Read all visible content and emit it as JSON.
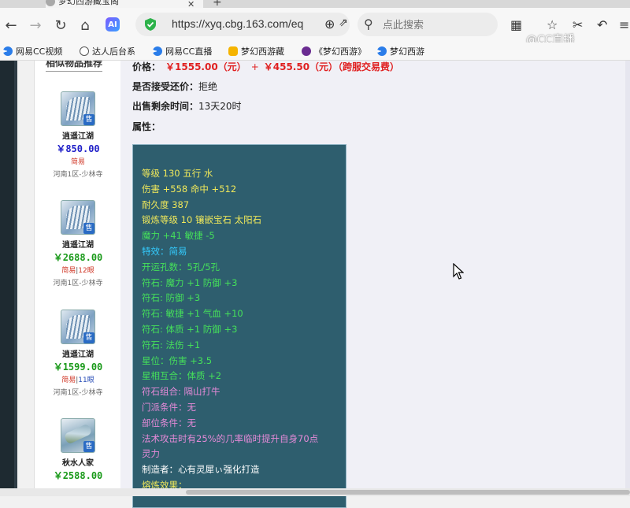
{
  "browser": {
    "tab_title": "梦幻西游藏宝阁",
    "url": "https://xyq.cbg.163.com/eq",
    "search_placeholder": "点此搜索",
    "ai_label": "AI",
    "watermark": "@CC直播",
    "bookmarks": [
      {
        "label": "网易CC视频",
        "icon": "cc-icon"
      },
      {
        "label": "达人后台系",
        "icon": "globe-icon"
      },
      {
        "label": "网易CC直播",
        "icon": "cc-icon"
      },
      {
        "label": "梦幻西游藏",
        "icon": "duck-icon"
      },
      {
        "label": "《梦幻西游》",
        "icon": "mhxy-icon"
      },
      {
        "label": "梦幻西游",
        "icon": "cc-icon"
      }
    ]
  },
  "sidebar": {
    "title": "相似物品推荐",
    "sale_badge": "售",
    "items": [
      {
        "name": "逍遥江湖",
        "price": "￥850.00",
        "price_color": "#2020c8",
        "tag": "简易",
        "tag_extra": "",
        "server": "河南1区-少林寺"
      },
      {
        "name": "逍遥江湖",
        "price": "￥2688.00",
        "price_color": "#1a9a1a",
        "tag": "简易",
        "tag_extra": "12眼",
        "server": "河南1区-少林寺"
      },
      {
        "name": "逍遥江湖",
        "price": "￥1599.00",
        "price_color": "#1a9a1a",
        "tag": "简易",
        "tag_extra": "11眼",
        "server": "河南1区-少林寺"
      },
      {
        "name": "秋水人家",
        "price": "￥2588.00",
        "price_color": "#1a9a1a",
        "tag": "",
        "tag_extra": "",
        "server": ""
      }
    ]
  },
  "detail": {
    "price_label": "价格：",
    "price_value": "￥1555.00（元）",
    "price_plus": "+",
    "fee_value": "￥455.50（元）（跨服交易费）",
    "ask_label": "是否接受还价：",
    "ask_value": "拒绝",
    "time_label": "出售剩余时间：",
    "time_value": "13天20时",
    "attr_label": "属性："
  },
  "attributes": [
    {
      "text": "等级 130 五行 水",
      "color": "yellow"
    },
    {
      "text": "伤害 +558 命中 +512",
      "color": "yellow"
    },
    {
      "text": "耐久度 387",
      "color": "yellow"
    },
    {
      "text": "锻炼等级 10 镶嵌宝石 太阳石",
      "color": "yellow"
    },
    {
      "text": "魔力 +41 敏捷 -5",
      "color": "green"
    },
    {
      "text": "特效：简易",
      "color": "cyan"
    },
    {
      "text": "开运孔数：5孔/5孔",
      "color": "green"
    },
    {
      "text": "符石: 魔力 +1 防御 +3",
      "color": "green"
    },
    {
      "text": "符石: 防御 +3",
      "color": "green"
    },
    {
      "text": "符石: 敏捷 +1 气血 +10",
      "color": "green"
    },
    {
      "text": "符石: 体质 +1 防御 +3",
      "color": "green"
    },
    {
      "text": "符石: 法伤 +1",
      "color": "green"
    },
    {
      "text": "星位：伤害 +3.5",
      "color": "green"
    },
    {
      "text": "星相互合：体质 +2",
      "color": "green"
    },
    {
      "text": "符石组合: 隔山打牛",
      "color": "pink"
    },
    {
      "text": "门派条件：无",
      "color": "pink"
    },
    {
      "text": "部位条件：无",
      "color": "pink"
    },
    {
      "text": "法术攻击时有25%的几率临时提升自身70点",
      "color": "pink"
    },
    {
      "text": "灵力",
      "color": "pink"
    },
    {
      "text": "制造者：心有灵犀ぃ强化打造",
      "color": "white"
    },
    {
      "text": "熔炼效果：",
      "color": "yellow"
    }
  ],
  "colors": {
    "attr_box_bg": "#2e5e6e",
    "price_red": "#e02020",
    "yellow": "#f0e85a",
    "green": "#45e05a",
    "cyan": "#33ccff",
    "pink": "#e58ad8"
  }
}
